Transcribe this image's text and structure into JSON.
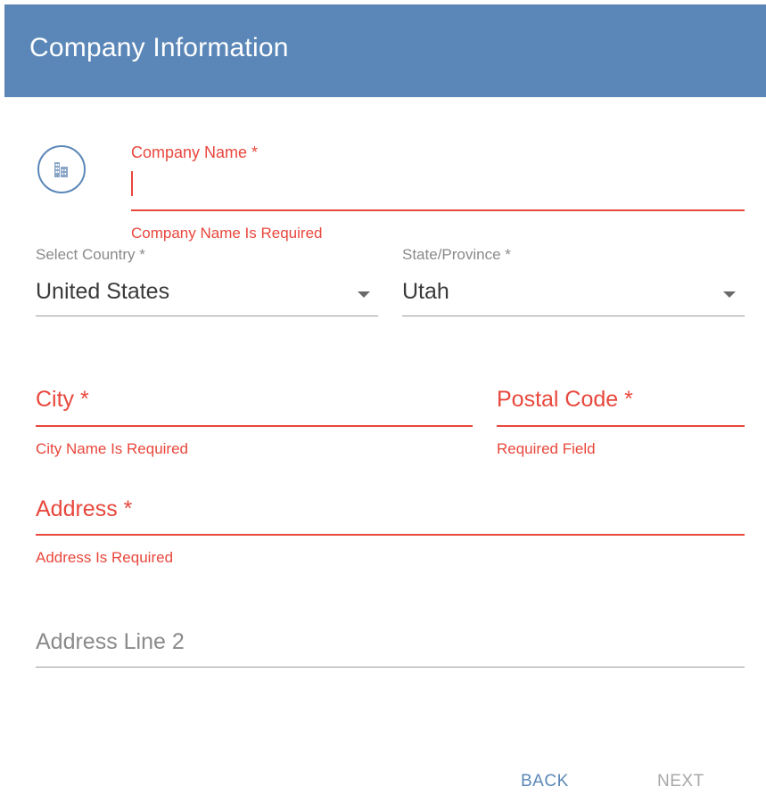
{
  "header": {
    "title": "Company Information"
  },
  "company": {
    "icon": "building-icon",
    "label": "Company Name *",
    "value": "",
    "error": "Company Name Is Required"
  },
  "country": {
    "label": "Select Country *",
    "value": "United States"
  },
  "state": {
    "label": "State/Province *",
    "value": "Utah"
  },
  "city": {
    "label": "City *",
    "value": "",
    "error": "City Name Is Required"
  },
  "postal": {
    "label": "Postal Code *",
    "value": "",
    "error": "Required Field"
  },
  "address": {
    "label": "Address *",
    "value": "",
    "error": "Address Is Required"
  },
  "address2": {
    "placeholder": "Address Line 2",
    "value": ""
  },
  "actions": {
    "back": "BACK",
    "next": "NEXT"
  },
  "colors": {
    "accent": "#5b87b8",
    "error": "#e8473c",
    "disabled": "#a8a8a8"
  }
}
